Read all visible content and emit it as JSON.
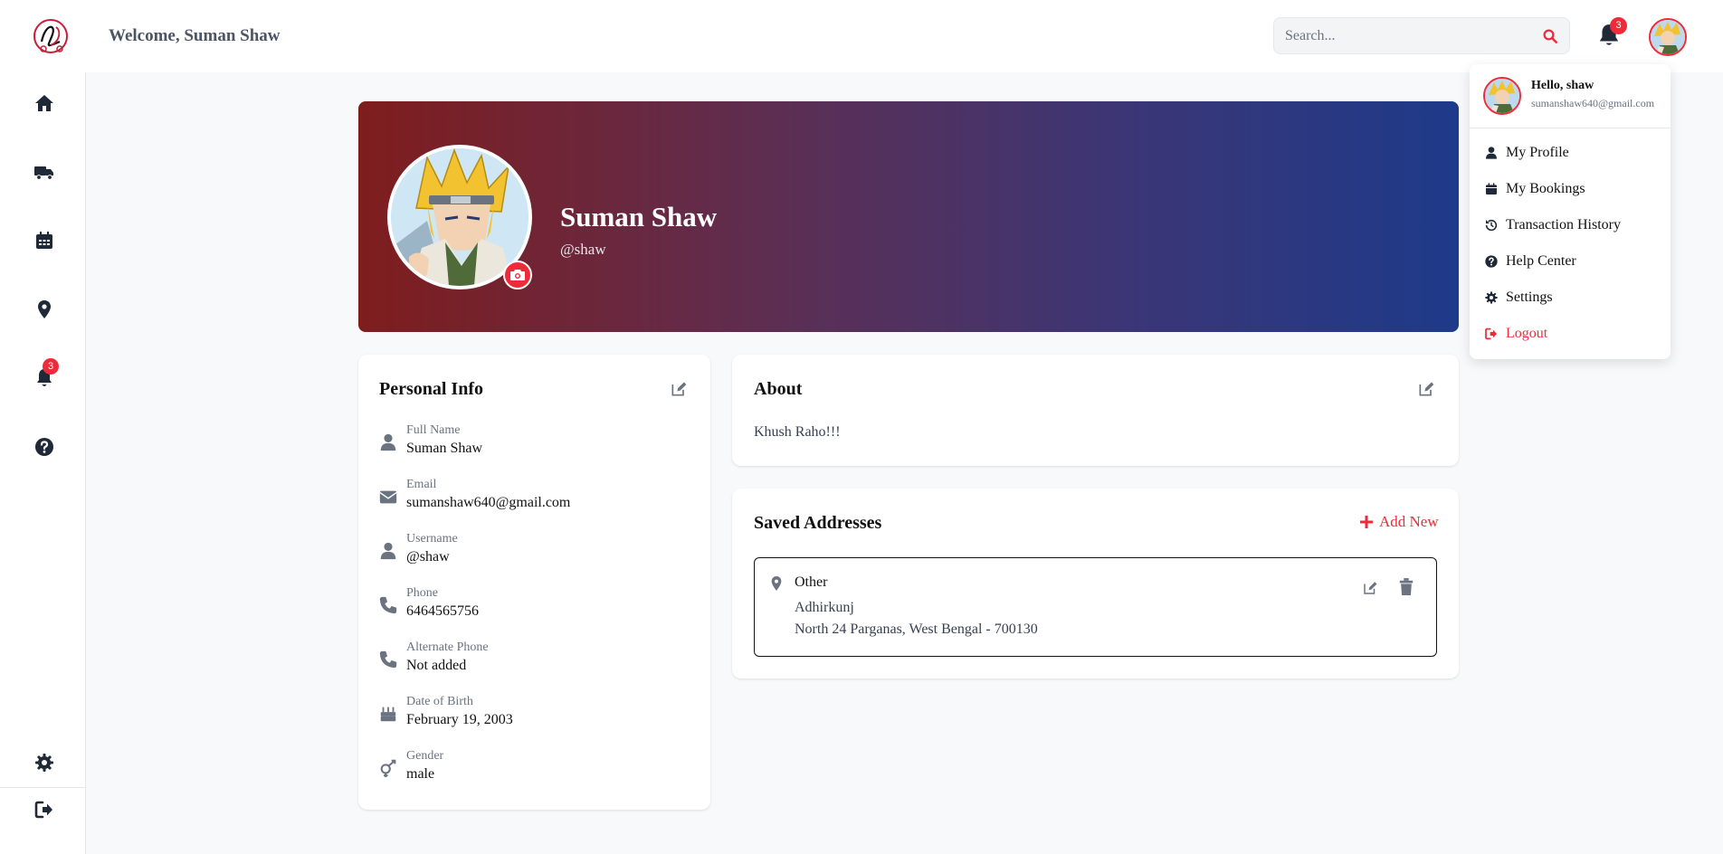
{
  "header": {
    "welcome": "Welcome, Suman Shaw",
    "search_placeholder": "Search...",
    "notification_count": "3"
  },
  "sidebar": {
    "items": [
      "home-icon",
      "truck-icon",
      "calendar-icon",
      "location-pin-icon",
      "bell-icon",
      "help-icon"
    ],
    "bottom_items": [
      "settings-icon",
      "logout-icon"
    ],
    "notification_count": "3"
  },
  "profile": {
    "name": "Suman Shaw",
    "username": "@shaw"
  },
  "personal_info": {
    "title": "Personal Info",
    "fields": [
      {
        "label": "Full Name",
        "value": "Suman Shaw",
        "icon": "user-icon"
      },
      {
        "label": "Email",
        "value": "sumanshaw640@gmail.com",
        "icon": "envelope-icon"
      },
      {
        "label": "Username",
        "value": "@shaw",
        "icon": "user-icon"
      },
      {
        "label": "Phone",
        "value": "6464565756",
        "icon": "phone-icon"
      },
      {
        "label": "Alternate Phone",
        "value": "Not added",
        "icon": "phone-icon"
      },
      {
        "label": "Date of Birth",
        "value": "February 19, 2003",
        "icon": "birthday-cake-icon"
      },
      {
        "label": "Gender",
        "value": "male",
        "icon": "gender-icon"
      }
    ]
  },
  "about": {
    "title": "About",
    "text": "Khush Raho!!!"
  },
  "saved_addresses": {
    "title": "Saved Addresses",
    "add_label": "Add New",
    "items": [
      {
        "type": "Other",
        "line1": "Adhirkunj",
        "line2": "North 24 Parganas, West Bengal - 700130"
      }
    ]
  },
  "dropdown": {
    "hello": "Hello, shaw",
    "email": "sumanshaw640@gmail.com",
    "items": [
      {
        "label": "My Profile",
        "icon": "user-icon"
      },
      {
        "label": "My Bookings",
        "icon": "calendar-icon"
      },
      {
        "label": "Transaction History",
        "icon": "history-icon"
      },
      {
        "label": "Help Center",
        "icon": "help-icon"
      },
      {
        "label": "Settings",
        "icon": "settings-icon"
      },
      {
        "label": "Logout",
        "icon": "logout-icon"
      }
    ]
  },
  "colors": {
    "accent": "#ef2b3a",
    "hero_start": "#7f1d1d",
    "hero_end": "#1e3a8a",
    "sidebar_icon": "#1f2937"
  }
}
